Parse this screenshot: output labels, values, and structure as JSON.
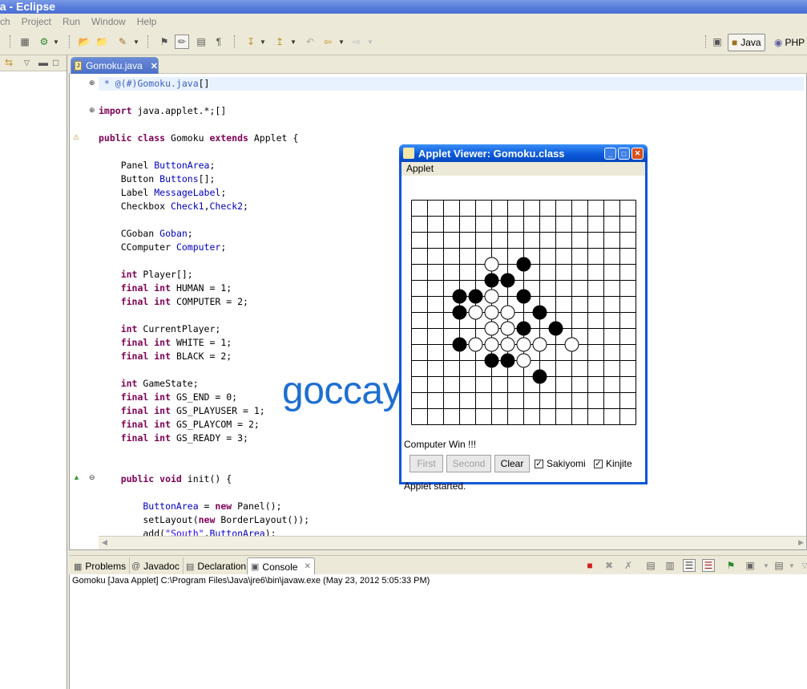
{
  "window": {
    "title": "va - Eclipse"
  },
  "menu": [
    "rch",
    "Project",
    "Run",
    "Window",
    "Help"
  ],
  "perspectives": [
    "Java",
    "PHP"
  ],
  "editor": {
    "tab_label": "Gomoku.java",
    "code_lines": [
      [
        {
          "t": " * @(#)Gomoku.java",
          "c": "cmt"
        },
        {
          "t": "[]",
          "c": ""
        }
      ],
      [],
      [
        {
          "t": "import",
          "c": "kw"
        },
        {
          "t": " java.applet.*;",
          "c": ""
        },
        {
          "t": "[]",
          "c": ""
        }
      ],
      [],
      [
        {
          "t": "public class",
          "c": "kw"
        },
        {
          "t": " Gomoku ",
          "c": ""
        },
        {
          "t": "extends",
          "c": "kw"
        },
        {
          "t": " Applet {",
          "c": ""
        }
      ],
      [],
      [
        {
          "t": "    Panel ",
          "c": ""
        },
        {
          "t": "ButtonArea",
          "c": "fld"
        },
        {
          "t": ";",
          "c": ""
        }
      ],
      [
        {
          "t": "    Button ",
          "c": ""
        },
        {
          "t": "Buttons",
          "c": "fld"
        },
        {
          "t": "[];",
          "c": ""
        }
      ],
      [
        {
          "t": "    Label ",
          "c": ""
        },
        {
          "t": "MessageLabel",
          "c": "fld"
        },
        {
          "t": ";",
          "c": ""
        }
      ],
      [
        {
          "t": "    Checkbox ",
          "c": ""
        },
        {
          "t": "Check1",
          "c": "fld"
        },
        {
          "t": ",",
          "c": ""
        },
        {
          "t": "Check2",
          "c": "fld"
        },
        {
          "t": ";",
          "c": ""
        }
      ],
      [],
      [
        {
          "t": "    CGoban ",
          "c": ""
        },
        {
          "t": "Goban",
          "c": "fld"
        },
        {
          "t": ";",
          "c": ""
        }
      ],
      [
        {
          "t": "    CComputer ",
          "c": ""
        },
        {
          "t": "Computer",
          "c": "fld"
        },
        {
          "t": ";",
          "c": ""
        }
      ],
      [],
      [
        {
          "t": "    int",
          "c": "kw"
        },
        {
          "t": " Player[];",
          "c": ""
        }
      ],
      [
        {
          "t": "    final int",
          "c": "kw"
        },
        {
          "t": " HUMAN = 1;",
          "c": ""
        }
      ],
      [
        {
          "t": "    final int",
          "c": "kw"
        },
        {
          "t": " COMPUTER = 2;",
          "c": ""
        }
      ],
      [],
      [
        {
          "t": "    int",
          "c": "kw"
        },
        {
          "t": " CurrentPlayer;",
          "c": ""
        }
      ],
      [
        {
          "t": "    final int",
          "c": "kw"
        },
        {
          "t": " WHITE = 1;",
          "c": ""
        }
      ],
      [
        {
          "t": "    final int",
          "c": "kw"
        },
        {
          "t": " BLACK = 2;",
          "c": ""
        }
      ],
      [],
      [
        {
          "t": "    int",
          "c": "kw"
        },
        {
          "t": " GameState;",
          "c": ""
        }
      ],
      [
        {
          "t": "    final int",
          "c": "kw"
        },
        {
          "t": " GS_END = 0;",
          "c": ""
        }
      ],
      [
        {
          "t": "    final int",
          "c": "kw"
        },
        {
          "t": " GS_PLAYUSER = 1;",
          "c": ""
        }
      ],
      [
        {
          "t": "    final int",
          "c": "kw"
        },
        {
          "t": " GS_PLAYCOM = 2;",
          "c": ""
        }
      ],
      [
        {
          "t": "    final int",
          "c": "kw"
        },
        {
          "t": " GS_READY = 3;",
          "c": ""
        }
      ],
      [],
      [],
      [
        {
          "t": "    public void",
          "c": "kw"
        },
        {
          "t": " init() {",
          "c": ""
        }
      ],
      [],
      [
        {
          "t": "        ButtonArea",
          "c": "fld"
        },
        {
          "t": " = ",
          "c": ""
        },
        {
          "t": "new",
          "c": "kw"
        },
        {
          "t": " Panel();",
          "c": ""
        }
      ],
      [
        {
          "t": "        setLayout(",
          "c": ""
        },
        {
          "t": "new",
          "c": "kw"
        },
        {
          "t": " BorderLayout());",
          "c": ""
        }
      ],
      [
        {
          "t": "        add(",
          "c": ""
        },
        {
          "t": "\"South\"",
          "c": "str"
        },
        {
          "t": ",",
          "c": ""
        },
        {
          "t": "ButtonArea",
          "c": "fld"
        },
        {
          "t": ");",
          "c": ""
        }
      ]
    ]
  },
  "bottom": {
    "tabs": [
      "Problems",
      "Javadoc",
      "Declaration",
      "Console"
    ],
    "active_tab": "Console",
    "console_line": "Gomoku [Java Applet] C:\\Program Files\\Java\\jre6\\bin\\javaw.exe (May 23, 2012 5:05:33 PM)"
  },
  "watermark": "goccay.vn",
  "applet": {
    "title": "Applet Viewer: Gomoku.class",
    "menu": "Applet",
    "board": {
      "size": 14,
      "black": [
        [
          7,
          4
        ],
        [
          5,
          5
        ],
        [
          6,
          5
        ],
        [
          3,
          6
        ],
        [
          4,
          6
        ],
        [
          7,
          6
        ],
        [
          3,
          7
        ],
        [
          8,
          7
        ],
        [
          7,
          8
        ],
        [
          9,
          8
        ],
        [
          3,
          9
        ],
        [
          5,
          10
        ],
        [
          6,
          10
        ],
        [
          8,
          11
        ]
      ],
      "white": [
        [
          5,
          4
        ],
        [
          5,
          6
        ],
        [
          4,
          7
        ],
        [
          5,
          7
        ],
        [
          6,
          7
        ],
        [
          5,
          8
        ],
        [
          6,
          8
        ],
        [
          4,
          9
        ],
        [
          5,
          9
        ],
        [
          6,
          9
        ],
        [
          7,
          9
        ],
        [
          8,
          9
        ],
        [
          10,
          9
        ],
        [
          7,
          10
        ]
      ]
    },
    "message": "Computer Win !!!",
    "buttons": {
      "first": "First",
      "second": "Second",
      "clear": "Clear"
    },
    "check1": "Sakiyomi",
    "check2": "Kinjite",
    "status": "Applet started."
  }
}
